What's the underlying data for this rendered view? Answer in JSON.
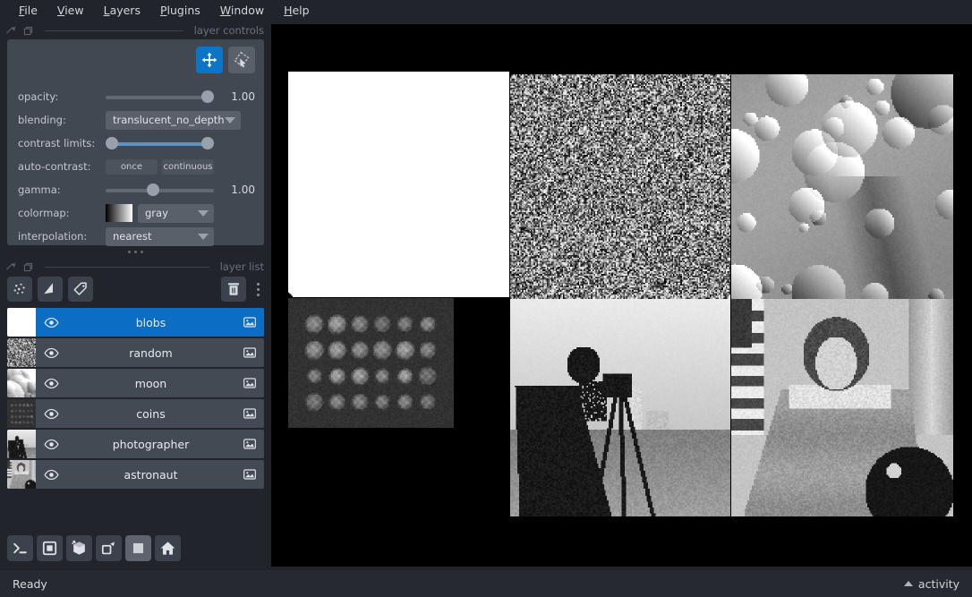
{
  "menubar": {
    "items": [
      {
        "label": "File",
        "accel": "F"
      },
      {
        "label": "View",
        "accel": "V"
      },
      {
        "label": "Layers",
        "accel": "L"
      },
      {
        "label": "Plugins",
        "accel": "P"
      },
      {
        "label": "Window",
        "accel": "W"
      },
      {
        "label": "Help",
        "accel": "H"
      }
    ]
  },
  "layer_controls": {
    "dock_title": "layer controls",
    "tools": [
      {
        "name": "pan-zoom",
        "active": true
      },
      {
        "name": "transform",
        "active": false
      }
    ],
    "opacity": {
      "label": "opacity:",
      "value": "1.00",
      "percent": 100
    },
    "blending": {
      "label": "blending:",
      "value": "translucent_no_depth"
    },
    "contrast_limits": {
      "label": "contrast limits:",
      "low_percent": 0,
      "high_percent": 100
    },
    "auto_contrast": {
      "label": "auto-contrast:",
      "once": "once",
      "continuous": "continuous"
    },
    "gamma": {
      "label": "gamma:",
      "value": "1.00",
      "percent": 38
    },
    "colormap": {
      "label": "colormap:",
      "value": "gray"
    },
    "interpolation": {
      "label": "interpolation:",
      "value": "nearest"
    }
  },
  "layer_list": {
    "dock_title": "layer list",
    "toolbar": [
      {
        "name": "new-points-layer"
      },
      {
        "name": "new-shapes-layer"
      },
      {
        "name": "new-labels-layer"
      },
      {
        "name": "delete-layer"
      },
      {
        "name": "layer-list-menu"
      }
    ],
    "layers": [
      {
        "name": "blobs",
        "selected": true,
        "visible": true,
        "type": "image"
      },
      {
        "name": "random",
        "selected": false,
        "visible": true,
        "type": "image"
      },
      {
        "name": "moon",
        "selected": false,
        "visible": true,
        "type": "image"
      },
      {
        "name": "coins",
        "selected": false,
        "visible": true,
        "type": "image"
      },
      {
        "name": "photographer",
        "selected": false,
        "visible": true,
        "type": "image"
      },
      {
        "name": "astronaut",
        "selected": false,
        "visible": true,
        "type": "image"
      }
    ]
  },
  "viewer_buttons": [
    {
      "name": "console",
      "active": false
    },
    {
      "name": "ndisplay-toggle",
      "active": false
    },
    {
      "name": "roll-dims",
      "active": false
    },
    {
      "name": "transpose-dims",
      "active": false
    },
    {
      "name": "grid-view",
      "active": true
    },
    {
      "name": "home",
      "active": false
    }
  ],
  "canvas": {
    "background": "#000000",
    "grid_mode": true,
    "grid_rows": 2,
    "grid_cols": 3,
    "cells": [
      {
        "layer": "blobs",
        "row": 0,
        "col": 0,
        "kind": "blobs"
      },
      {
        "layer": "random",
        "row": 0,
        "col": 1,
        "kind": "noise"
      },
      {
        "layer": "moon",
        "row": 0,
        "col": 2,
        "kind": "moon"
      },
      {
        "layer": "coins",
        "row": 1,
        "col": 0,
        "kind": "coins"
      },
      {
        "layer": "photographer",
        "row": 1,
        "col": 1,
        "kind": "photographer"
      },
      {
        "layer": "astronaut",
        "row": 1,
        "col": 2,
        "kind": "astronaut"
      }
    ]
  },
  "statusbar": {
    "status": "Ready",
    "activity": "activity"
  },
  "colors": {
    "window_bg": "#21242b",
    "panel_bg": "#414851",
    "row_bg": "#434a54",
    "selected_blue": "#0b6ec4",
    "accent_blue": "#0b76c8",
    "text": "#d3d6db",
    "muted_text": "#6b717c",
    "statusbar_bg": "#262930"
  }
}
